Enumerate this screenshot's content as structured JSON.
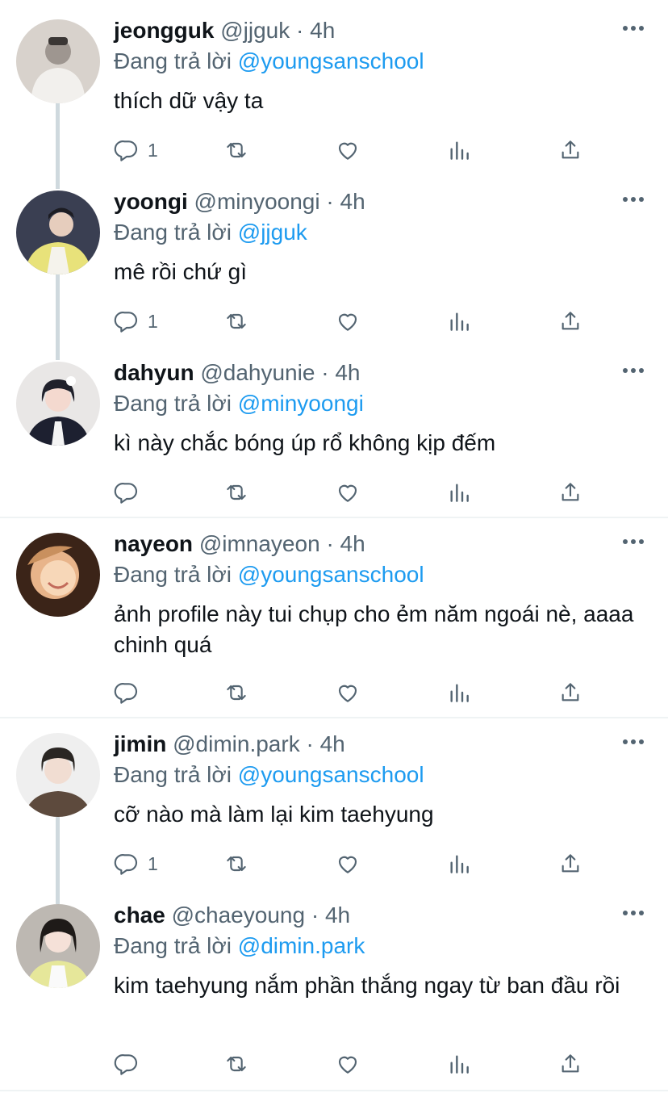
{
  "reply_prefix": "Đang trả lời",
  "tweets": [
    {
      "name": "jeongguk",
      "handle": "@jjguk",
      "time": "4h",
      "reply_to": "@youngsanschool",
      "text": "thích dữ vậy ta",
      "reply_count": "1",
      "avatar_colors": [
        "#d8d2cc",
        "#9e9690",
        "#f2f0ed"
      ]
    },
    {
      "name": "yoongi",
      "handle": "@minyoongi",
      "time": "4h",
      "reply_to": "@jjguk",
      "text": "mê rồi chứ gì",
      "reply_count": "1",
      "avatar_colors": [
        "#3a3f52",
        "#e8e27a",
        "#f5f3ec"
      ]
    },
    {
      "name": "dahyun",
      "handle": "@dahyunie",
      "time": "4h",
      "reply_to": "@minyoongi",
      "text": "kì này chắc bóng úp rổ không kịp đếm",
      "reply_count": "",
      "avatar_colors": [
        "#e9e7e6",
        "#1d2030",
        "#f4d9cf"
      ]
    },
    {
      "name": "nayeon",
      "handle": "@imnayeon",
      "time": "4h",
      "reply_to": "@youngsanschool",
      "text": "ảnh profile này tui chụp cho ẻm năm ngoái nè, aaaa chinh quá",
      "reply_count": "",
      "avatar_colors": [
        "#3b2418",
        "#e8b48a",
        "#f7d7b8"
      ]
    },
    {
      "name": "jimin",
      "handle": "@dimin.park",
      "time": "4h",
      "reply_to": "@youngsanschool",
      "text": "cỡ nào mà làm lại kim taehyung",
      "reply_count": "1",
      "avatar_colors": [
        "#efefef",
        "#2a2623",
        "#5d4a3d"
      ]
    },
    {
      "name": "chae",
      "handle": "@chaeyoung",
      "time": "4h",
      "reply_to": "@dimin.park",
      "text": "kim taehyung nắm phần thắng ngay từ ban đầu rồi",
      "reply_count": "",
      "avatar_colors": [
        "#bdb8b2",
        "#1e1a18",
        "#e6e79a"
      ]
    }
  ],
  "icons": [
    "reply-icon",
    "retweet-icon",
    "like-icon",
    "analytics-icon",
    "share-icon",
    "more-icon"
  ],
  "colors": {
    "link": "#1d9bf0",
    "secondary_text": "#536471",
    "primary_text": "#0f1419",
    "thread_line": "#cfd9de",
    "divider": "#eff3f4"
  }
}
